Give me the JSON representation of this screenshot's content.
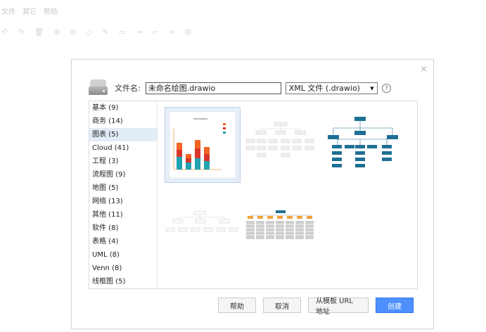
{
  "bg_menu": [
    "文件",
    "其它",
    "帮助"
  ],
  "dialog": {
    "close": "×",
    "filename_label": "文件名:",
    "filename_value": "未命名绘图.drawio",
    "format_value": "XML 文件 (.drawio)",
    "help_symbol": "?",
    "categories": [
      "基本 (9)",
      "商务 (14)",
      "图表 (5)",
      "Cloud (41)",
      "工程 (3)",
      "流程图 (9)",
      "地图 (5)",
      "网络 (13)",
      "其他 (11)",
      "软件 (8)",
      "表格 (4)",
      "UML (8)",
      "Venn (8)",
      "线框图 (5)"
    ],
    "selected_category_index": 2,
    "buttons": {
      "help": "帮助",
      "cancel": "取消",
      "from_url": "从模板 URL 地址",
      "create": "创建"
    }
  },
  "colors": {
    "accent": "#4d90fe",
    "select_bg": "#e2ecf7",
    "org_blue": "#1e6f94",
    "bar_orange": "#f26522",
    "bar_red": "#d9362b",
    "bar_teal": "#21a2b0"
  }
}
